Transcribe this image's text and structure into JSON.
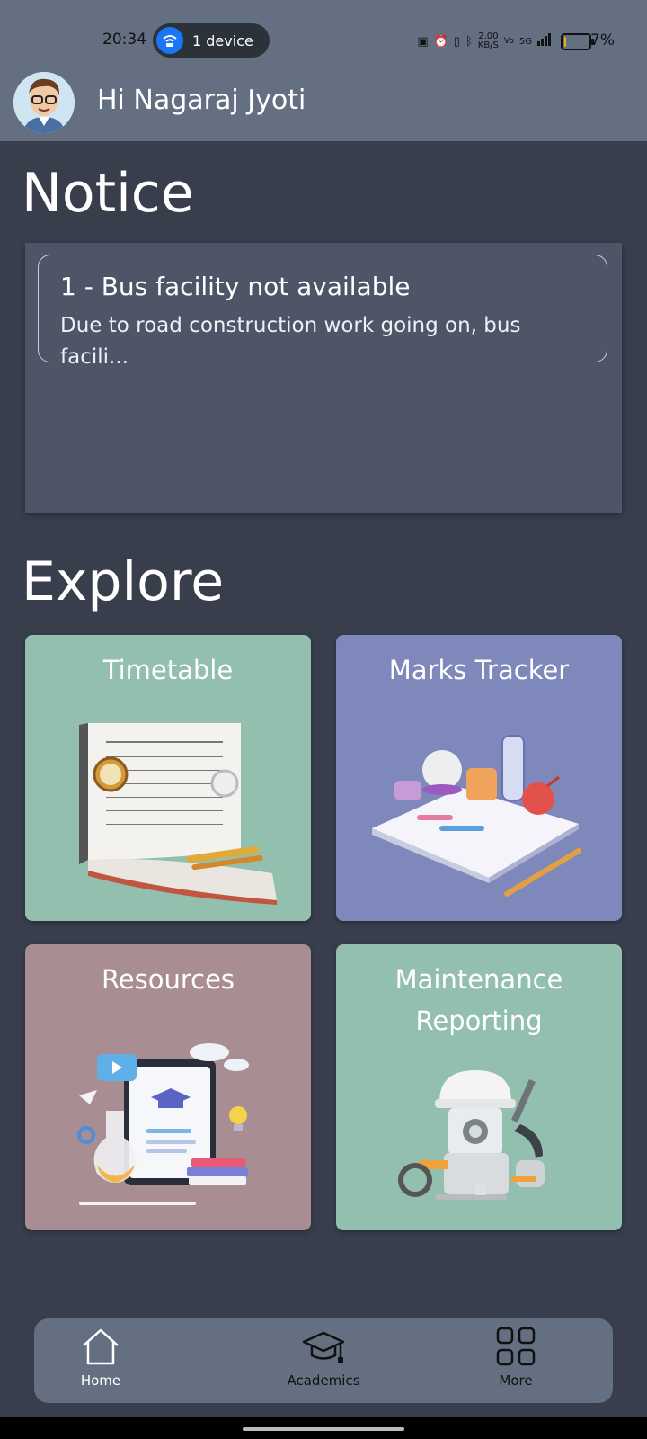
{
  "status": {
    "time": "20:34",
    "hotspot": "1 device",
    "speed": "2.00",
    "speed_unit": "KB/S",
    "network": "5G",
    "battery_pct": "7%",
    "battery_level": 0.07
  },
  "header": {
    "greeting": "Hi Nagaraj Jyoti"
  },
  "notice": {
    "heading": "Notice",
    "items": [
      {
        "title": "1 - Bus facility not available",
        "body": "Due to road construction work going on, bus facili..."
      }
    ]
  },
  "explore": {
    "heading": "Explore",
    "tiles": [
      {
        "label": "Timetable",
        "color": "#93bfae"
      },
      {
        "label": "Marks Tracker",
        "color": "#7f88bb"
      },
      {
        "label": "Resources",
        "color": "#a88d92"
      },
      {
        "label": "Maintenance Reporting",
        "color": "#93bfae"
      }
    ]
  },
  "nav": {
    "items": [
      {
        "label": "Home",
        "icon": "home-icon"
      },
      {
        "label": "Academics",
        "icon": "graduation-cap-icon"
      },
      {
        "label": "More",
        "icon": "grid-icon"
      }
    ]
  },
  "colors": {
    "background": "#383e4c",
    "header": "#646f82",
    "panel": "#4e5567"
  }
}
